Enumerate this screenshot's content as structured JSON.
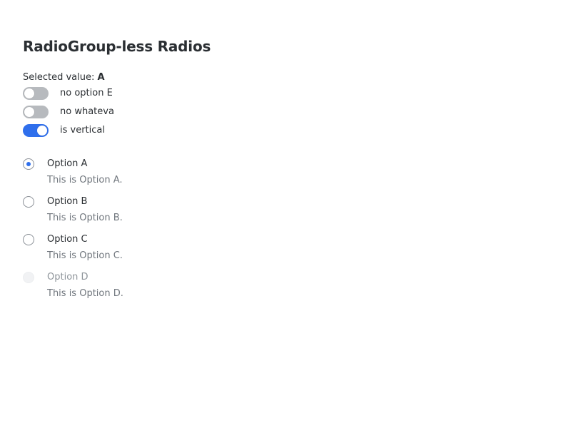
{
  "page": {
    "title": "RadioGroup-less Radios"
  },
  "selected": {
    "label": "Selected value: ",
    "value": "A"
  },
  "toggles": [
    {
      "label": "no option E",
      "on": false
    },
    {
      "label": "no whateva",
      "on": false
    },
    {
      "label": "is vertical",
      "on": true
    }
  ],
  "radios": [
    {
      "label": "Option A",
      "description": "This is Option A.",
      "checked": true,
      "disabled": false
    },
    {
      "label": "Option B",
      "description": "This is Option B.",
      "checked": false,
      "disabled": false
    },
    {
      "label": "Option C",
      "description": "This is Option C.",
      "checked": false,
      "disabled": false
    },
    {
      "label": "Option D",
      "description": "This is Option D.",
      "checked": false,
      "disabled": true
    }
  ],
  "colors": {
    "accent": "#2f6fec",
    "switch_off": "#b7babe",
    "text": "#2b2f33",
    "muted": "#70767d"
  }
}
